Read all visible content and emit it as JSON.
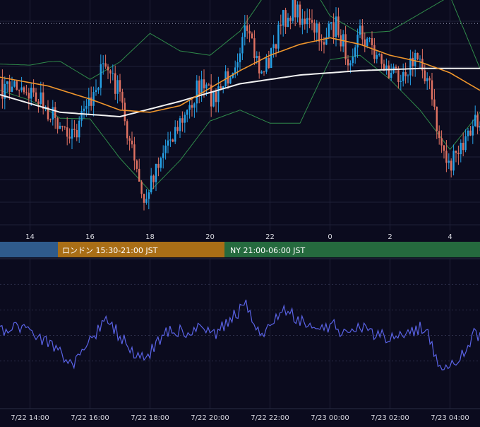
{
  "colors": {
    "background": "#0b0b1e",
    "grid": "#1f2138",
    "candle_up": "#26a2e8",
    "candle_down": "#e07262",
    "bollinger": "#2f8a4a",
    "ma_fast": "#f0962c",
    "ma_slow": "#f2f2f2",
    "oscillator": "#5a63e6",
    "session_tokyo": "#2f5b8c",
    "session_london": "#a96e16",
    "session_ny": "#256a3e",
    "label_text": "#ffffff"
  },
  "price_axis": {
    "ticks": [
      "14",
      "16",
      "18",
      "20",
      "22",
      "0",
      "2",
      "4"
    ]
  },
  "sessions": [
    {
      "label": "",
      "color_key": "session_tokyo"
    },
    {
      "label": "ロンドン 15:30-21:00 JST",
      "color_key": "session_london"
    },
    {
      "label": "NY 21:00-06:00 JST",
      "color_key": "session_ny"
    }
  ],
  "oscillator_axis": {
    "ticks": [
      "7/22 14:00",
      "7/22 16:00",
      "7/22 18:00",
      "7/22 20:00",
      "7/22 22:00",
      "7/23 00:00",
      "7/23 02:00",
      "7/23 04:00"
    ]
  },
  "chart_data": [
    {
      "type": "candlestick",
      "x_start": "7/22 13:00",
      "x_end": "7/23 05:00",
      "x_unit": "hours",
      "close_path_keypoints": [
        [
          13.0,
          0.38
        ],
        [
          13.6,
          0.35
        ],
        [
          14.2,
          0.41
        ],
        [
          14.8,
          0.5
        ],
        [
          15.5,
          0.58
        ],
        [
          16.0,
          0.42
        ],
        [
          16.5,
          0.26
        ],
        [
          17.0,
          0.4
        ],
        [
          17.4,
          0.66
        ],
        [
          17.8,
          0.91
        ],
        [
          18.2,
          0.72
        ],
        [
          18.7,
          0.58
        ],
        [
          19.2,
          0.5
        ],
        [
          19.6,
          0.36
        ],
        [
          20.2,
          0.42
        ],
        [
          20.8,
          0.25
        ],
        [
          21.2,
          0.12
        ],
        [
          21.7,
          0.3
        ],
        [
          22.0,
          0.23
        ],
        [
          22.4,
          0.07
        ],
        [
          22.8,
          0.0
        ],
        [
          23.4,
          0.1
        ],
        [
          23.8,
          0.15
        ],
        [
          24.2,
          0.08
        ],
        [
          24.6,
          0.23
        ],
        [
          25.0,
          0.11
        ],
        [
          25.6,
          0.22
        ],
        [
          26.0,
          0.31
        ],
        [
          26.5,
          0.28
        ],
        [
          27.0,
          0.23
        ],
        [
          27.3,
          0.35
        ],
        [
          27.6,
          0.58
        ],
        [
          28.0,
          0.73
        ],
        [
          28.4,
          0.64
        ],
        [
          28.8,
          0.54
        ],
        [
          29.0,
          0.51
        ]
      ],
      "ma_slow_keypoints": [
        [
          13.0,
          0.4
        ],
        [
          15.0,
          0.48
        ],
        [
          17.0,
          0.5
        ],
        [
          19.0,
          0.43
        ],
        [
          21.0,
          0.35
        ],
        [
          23.0,
          0.31
        ],
        [
          25.0,
          0.29
        ],
        [
          27.0,
          0.28
        ],
        [
          29.0,
          0.28
        ]
      ],
      "ma_fast_keypoints": [
        [
          13.0,
          0.32
        ],
        [
          14.6,
          0.36
        ],
        [
          16.0,
          0.42
        ],
        [
          17.0,
          0.47
        ],
        [
          18.0,
          0.48
        ],
        [
          19.0,
          0.45
        ],
        [
          20.0,
          0.37
        ],
        [
          21.0,
          0.29
        ],
        [
          22.0,
          0.22
        ],
        [
          23.0,
          0.17
        ],
        [
          24.0,
          0.14
        ],
        [
          25.0,
          0.17
        ],
        [
          26.0,
          0.22
        ],
        [
          27.0,
          0.25
        ],
        [
          28.0,
          0.3
        ],
        [
          29.0,
          0.38
        ]
      ],
      "bollinger_halfwidth_keypoints": [
        [
          13.0,
          0.06
        ],
        [
          14.0,
          0.08
        ],
        [
          15.0,
          0.13
        ],
        [
          16.0,
          0.09
        ],
        [
          17.0,
          0.22
        ],
        [
          18.0,
          0.36
        ],
        [
          19.0,
          0.25
        ],
        [
          20.0,
          0.15
        ],
        [
          21.0,
          0.18
        ],
        [
          22.0,
          0.31
        ],
        [
          23.0,
          0.36
        ],
        [
          24.0,
          0.1
        ],
        [
          25.0,
          0.05
        ],
        [
          26.0,
          0.11
        ],
        [
          27.0,
          0.22
        ],
        [
          28.0,
          0.35
        ],
        [
          29.0,
          0.1
        ]
      ],
      "reference_level": 0.075
    },
    {
      "type": "line",
      "x_start": "7/22 13:00",
      "x_end": "7/23 05:00",
      "x_unit": "hours",
      "keypoints": [
        [
          13.0,
          0.52
        ],
        [
          13.6,
          0.45
        ],
        [
          14.2,
          0.52
        ],
        [
          14.8,
          0.65
        ],
        [
          15.5,
          0.78
        ],
        [
          16.0,
          0.58
        ],
        [
          16.5,
          0.4
        ],
        [
          17.0,
          0.54
        ],
        [
          17.4,
          0.66
        ],
        [
          17.8,
          0.76
        ],
        [
          18.2,
          0.6
        ],
        [
          18.7,
          0.47
        ],
        [
          19.2,
          0.52
        ],
        [
          19.6,
          0.48
        ],
        [
          20.2,
          0.52
        ],
        [
          20.8,
          0.37
        ],
        [
          21.2,
          0.29
        ],
        [
          21.7,
          0.52
        ],
        [
          22.0,
          0.47
        ],
        [
          22.4,
          0.33
        ],
        [
          22.8,
          0.37
        ],
        [
          23.4,
          0.47
        ],
        [
          23.8,
          0.49
        ],
        [
          24.2,
          0.45
        ],
        [
          24.6,
          0.57
        ],
        [
          25.0,
          0.47
        ],
        [
          25.6,
          0.53
        ],
        [
          26.0,
          0.56
        ],
        [
          26.5,
          0.53
        ],
        [
          27.0,
          0.47
        ],
        [
          27.3,
          0.55
        ],
        [
          27.6,
          0.76
        ],
        [
          28.0,
          0.82
        ],
        [
          28.4,
          0.71
        ],
        [
          28.8,
          0.52
        ],
        [
          29.0,
          0.54
        ]
      ],
      "gridlines_y": [
        0.1,
        0.32,
        0.54,
        0.76
      ]
    }
  ]
}
